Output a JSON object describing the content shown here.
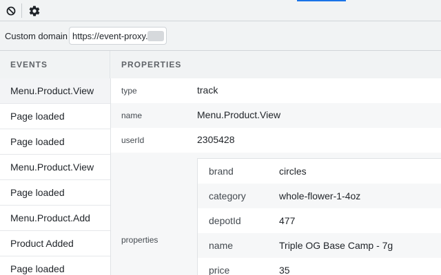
{
  "toolbar": {
    "clear_icon": "block-icon",
    "settings_icon": "gear-icon"
  },
  "domain": {
    "label": "Custom domain",
    "value": "https://event-proxy."
  },
  "headers": {
    "events": "EVENTS",
    "properties": "PROPERTIES"
  },
  "events": [
    "Menu.Product.View",
    "Page loaded",
    "Page loaded",
    "Menu.Product.View",
    "Page loaded",
    "Menu.Product.Add",
    "Product Added",
    "Page loaded"
  ],
  "properties": {
    "type": {
      "key": "type",
      "value": "track"
    },
    "name": {
      "key": "name",
      "value": "Menu.Product.View"
    },
    "userId": {
      "key": "userId",
      "value": "2305428"
    },
    "properties_key": "properties",
    "nested": [
      {
        "key": "brand",
        "value": "circles"
      },
      {
        "key": "category",
        "value": "whole-flower-1-4oz"
      },
      {
        "key": "depotId",
        "value": "477"
      },
      {
        "key": "name",
        "value": "Triple OG Base Camp - 7g"
      },
      {
        "key": "price",
        "value": "35"
      }
    ]
  },
  "colors": {
    "accent": "#1a73e8",
    "toolbar_bg": "#f1f3f4",
    "row_shade": "#f6f7f8"
  }
}
